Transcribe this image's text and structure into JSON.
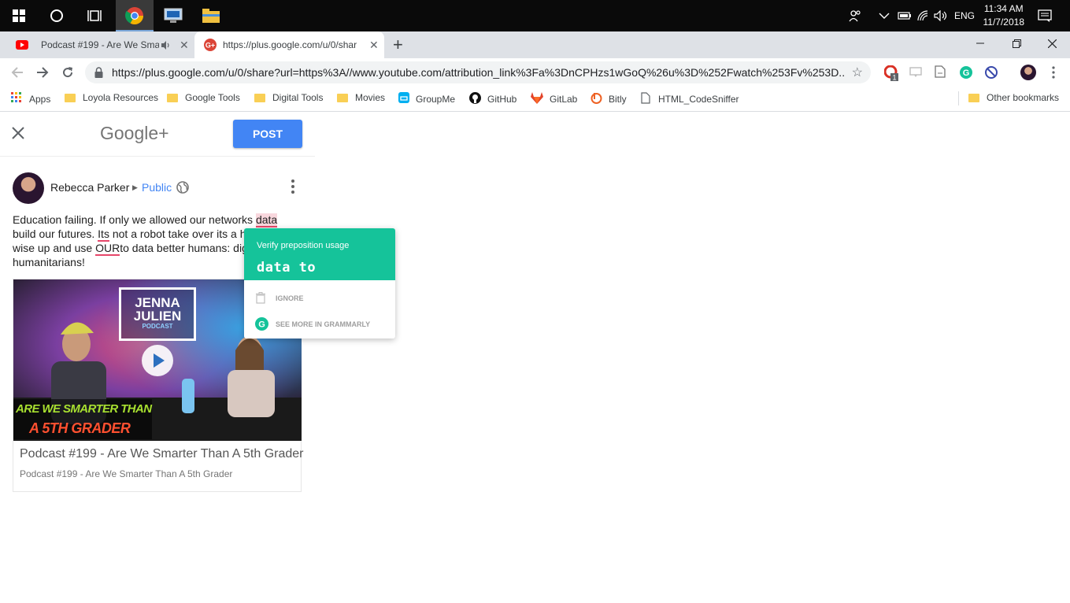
{
  "taskbar": {
    "time": "11:34 AM",
    "date": "11/7/2018",
    "language": "ENG"
  },
  "tabs": [
    {
      "title": "Podcast #199 - Are We Smar",
      "active": false
    },
    {
      "title": "https://plus.google.com/u/0/shar",
      "active": true
    }
  ],
  "toolbar": {
    "url": "https://plus.google.com/u/0/share?url=https%3A//www.youtube.com/attribution_link%3Fa%3DnCPHzs1wGoQ%26u%3D%252Fwatch%253Fv%253D...",
    "ext_badge": "1"
  },
  "bookmarks": [
    {
      "label": "Apps",
      "icon": "apps-grid-icon"
    },
    {
      "label": "Loyola Resources",
      "icon": "folder-icon"
    },
    {
      "label": "Google Tools",
      "icon": "folder-icon"
    },
    {
      "label": "Digital Tools",
      "icon": "folder-icon"
    },
    {
      "label": "Movies",
      "icon": "folder-icon"
    },
    {
      "label": "GroupMe",
      "icon": "groupme-icon"
    },
    {
      "label": "GitHub",
      "icon": "github-icon"
    },
    {
      "label": "GitLab",
      "icon": "gitlab-icon"
    },
    {
      "label": "Bitly",
      "icon": "bitly-icon"
    },
    {
      "label": "HTML_CodeSniffer",
      "icon": "page-icon"
    }
  ],
  "other_bookmarks": "Other bookmarks",
  "gplus": {
    "logo": "Google+",
    "post_label": "POST",
    "author": "Rebecca Parker",
    "audience": "Public",
    "text": {
      "p1": "Education failing. If only we allowed our networks ",
      "w_data": "data",
      "p2": "build our futures. ",
      "w_its": "Its",
      "p3": " not a robot take over its a h",
      "p4": "wise up and use ",
      "w_our": "OUR",
      "p5": "to data better humans: dig",
      "p6": "humanitarians!"
    },
    "card": {
      "title": "Podcast #199 - Are We Smarter Than A 5th Grader",
      "subtitle": "Podcast #199 - Are We Smarter Than A 5th Grader",
      "thumb_logo_line1": "JENNA",
      "thumb_logo_line2": "JULIEN",
      "thumb_logo_line3": "PODCAST",
      "thumb_caption1": "ARE WE SMARTER THAN",
      "thumb_caption2": "A 5TH GRADER"
    }
  },
  "grammarly": {
    "title": "Verify preposition usage",
    "suggestion": "data to",
    "ignore": "IGNORE",
    "see_more": "SEE MORE IN GRAMMARLY",
    "color": "#15c39a"
  }
}
